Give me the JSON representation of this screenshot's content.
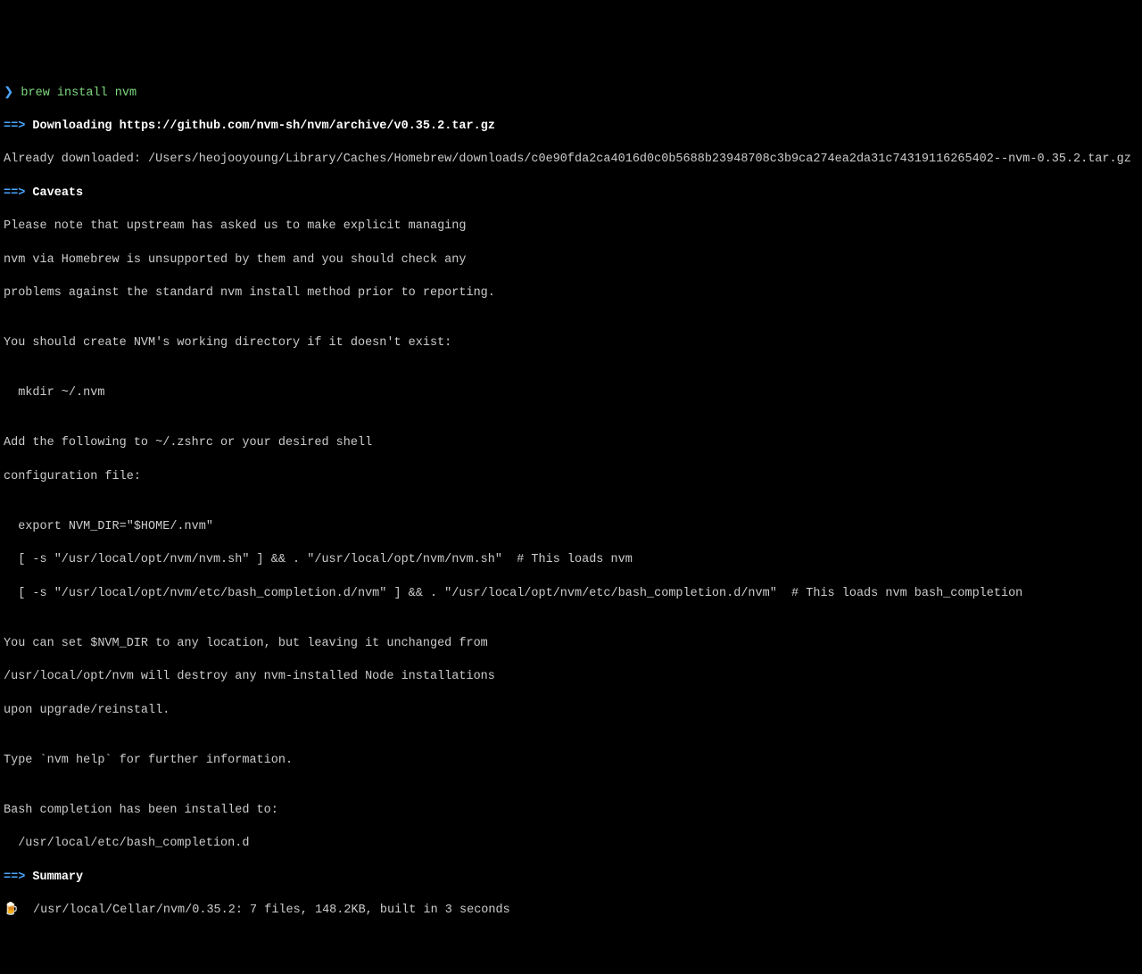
{
  "prompt": {
    "symbol": "❯",
    "command": "brew install nvm"
  },
  "sections": {
    "downloading": {
      "arrow": "==>",
      "label": "Downloading",
      "url": "https://github.com/nvm-sh/nvm/archive/v0.35.2.tar.gz"
    },
    "already_downloaded": "Already downloaded: /Users/heojooyoung/Library/Caches/Homebrew/downloads/c0e90fda2ca4016d0c0b5688b23948708c3b9ca274ea2da31c74319116265402--nvm-0.35.2.tar.gz",
    "caveats": {
      "arrow": "==>",
      "label": "Caveats"
    },
    "caveats_body": {
      "l1": "Please note that upstream has asked us to make explicit managing",
      "l2": "nvm via Homebrew is unsupported by them and you should check any",
      "l3": "problems against the standard nvm install method prior to reporting.",
      "l4": "",
      "l5": "You should create NVM's working directory if it doesn't exist:",
      "l6": "",
      "l7": "  mkdir ~/.nvm",
      "l8": "",
      "l9": "Add the following to ~/.zshrc or your desired shell",
      "l10": "configuration file:",
      "l11": "",
      "l12": "  export NVM_DIR=\"$HOME/.nvm\"",
      "l13": "  [ -s \"/usr/local/opt/nvm/nvm.sh\" ] && . \"/usr/local/opt/nvm/nvm.sh\"  # This loads nvm",
      "l14": "  [ -s \"/usr/local/opt/nvm/etc/bash_completion.d/nvm\" ] && . \"/usr/local/opt/nvm/etc/bash_completion.d/nvm\"  # This loads nvm bash_completion",
      "l15": "",
      "l16": "You can set $NVM_DIR to any location, but leaving it unchanged from",
      "l17": "/usr/local/opt/nvm will destroy any nvm-installed Node installations",
      "l18": "upon upgrade/reinstall.",
      "l19": "",
      "l20": "Type `nvm help` for further information.",
      "l21": "",
      "l22": "Bash completion has been installed to:",
      "l23": "  /usr/local/etc/bash_completion.d"
    },
    "summary": {
      "arrow": "==>",
      "label": "Summary"
    },
    "summary_line": {
      "icon": "🍺",
      "text": "  /usr/local/Cellar/nvm/0.35.2: 7 files, 148.2KB, built in 3 seconds"
    }
  }
}
